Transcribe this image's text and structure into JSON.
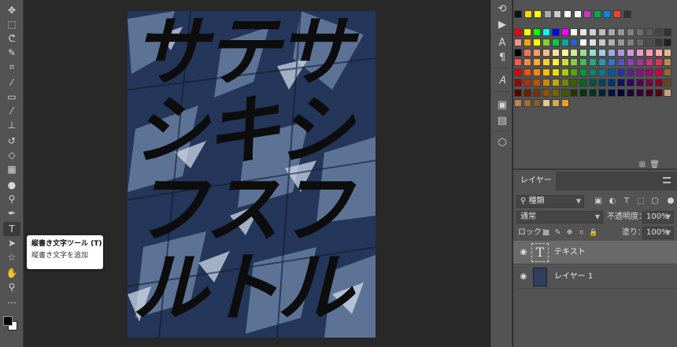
{
  "toolbar": {
    "tools": [
      {
        "name": "move-tool-icon",
        "glyph": "✥"
      },
      {
        "name": "marquee-tool-icon",
        "glyph": "⬚"
      },
      {
        "name": "lasso-tool-icon",
        "glyph": "ᕦ"
      },
      {
        "name": "quick-select-tool-icon",
        "glyph": "✎"
      },
      {
        "name": "crop-tool-icon",
        "glyph": "⌗"
      },
      {
        "name": "eyedropper-tool-icon",
        "glyph": "⁄"
      },
      {
        "name": "healing-brush-tool-icon",
        "glyph": "▭"
      },
      {
        "name": "brush-tool-icon",
        "glyph": "⁄"
      },
      {
        "name": "clone-stamp-tool-icon",
        "glyph": "⊥"
      },
      {
        "name": "history-brush-tool-icon",
        "glyph": "↺"
      },
      {
        "name": "eraser-tool-icon",
        "glyph": "◇"
      },
      {
        "name": "gradient-tool-icon",
        "glyph": "▦"
      },
      {
        "name": "blur-tool-icon",
        "glyph": "●"
      },
      {
        "name": "dodge-tool-icon",
        "glyph": "⚲"
      },
      {
        "name": "pen-tool-icon",
        "glyph": "✒"
      },
      {
        "name": "type-tool-icon",
        "glyph": "T"
      },
      {
        "name": "path-select-tool-icon",
        "glyph": "➤"
      },
      {
        "name": "shape-tool-icon",
        "glyph": "☆"
      },
      {
        "name": "hand-tool-icon",
        "glyph": "✋"
      },
      {
        "name": "zoom-tool-icon",
        "glyph": "⚲"
      },
      {
        "name": "more-tools-icon",
        "glyph": "···"
      }
    ],
    "active_tool": "type-tool-icon"
  },
  "tooltip": {
    "title": "縦書き文字ツール (T)",
    "description": "縦書き文字を追加"
  },
  "document": {
    "poster_lines": [
      "サテサ",
      "シキシ",
      "フスフ",
      "ルトル"
    ]
  },
  "swatches": {
    "recent": [
      "#111111",
      "#ffd800",
      "#ffff00",
      "#aaaaaa",
      "#cccccc",
      "#ffffff",
      "#ffffff",
      "#cc33cc",
      "#00aa55",
      "#0088dd",
      "#ee4433",
      "#333333"
    ],
    "grid": [
      [
        "#ff0000",
        "#ffff00",
        "#00ff00",
        "#00ffff",
        "#0000ff",
        "#ff00ff",
        "#ffffff",
        "#e6e6e6",
        "#d0d0d0",
        "#bcbcbc",
        "#a8a8a8",
        "#969696",
        "#828282",
        "#6e6e6e",
        "#5a5a5a",
        "#464646",
        "#323232"
      ],
      [
        "#f5908a",
        "#ffa500",
        "#ffff00",
        "#88cc33",
        "#00cc44",
        "#00aa99",
        "#2266cc",
        "#ffffff",
        "#e0e0e0",
        "#c8c8c8",
        "#b0b0b0",
        "#999999",
        "#808080",
        "#686868",
        "#505050",
        "#383838",
        "#202020"
      ],
      [
        "#000000",
        "#ff7755",
        "#ff9966",
        "#ffbb88",
        "#ffdd99",
        "#ffff99",
        "#ccee99",
        "#99dd99",
        "#99ddcc",
        "#99ccee",
        "#99aadd",
        "#aa99dd",
        "#cc99dd",
        "#ee99cc",
        "#ff99bb",
        "#ffaaaa",
        "#ddbb99"
      ],
      [
        "#ff5555",
        "#ff8844",
        "#ffaa33",
        "#ffcc33",
        "#ffee33",
        "#ccdd33",
        "#88cc44",
        "#44bb55",
        "#22aa88",
        "#2299bb",
        "#3377cc",
        "#5555bb",
        "#8844bb",
        "#aa3399",
        "#cc3377",
        "#dd3355",
        "#bb8855"
      ],
      [
        "#dd0000",
        "#ee5500",
        "#ff8800",
        "#ffbb00",
        "#eedd00",
        "#aacc00",
        "#55aa00",
        "#009933",
        "#008866",
        "#007799",
        "#0055aa",
        "#2233aa",
        "#552299",
        "#881188",
        "#aa0066",
        "#cc0044",
        "#996633"
      ],
      [
        "#990000",
        "#aa3300",
        "#bb5500",
        "#cc8800",
        "#bbaa00",
        "#778800",
        "#336600",
        "#006622",
        "#005544",
        "#004466",
        "#003377",
        "#111166",
        "#330066",
        "#550055",
        "#770044",
        "#880022",
        "#664422"
      ],
      [
        "#550000",
        "#662200",
        "#773300",
        "#885500",
        "#776600",
        "#445500",
        "#223300",
        "#003311",
        "#003322",
        "#002233",
        "#001144",
        "#000033",
        "#1a0033",
        "#330033",
        "#440022",
        "#550011",
        "#c9a27a"
      ],
      [
        "#b8864b",
        "#a06d38",
        "#8c5a2b",
        "#e8c88a",
        "#d4a857",
        "#f0a020"
      ]
    ]
  },
  "layers_panel": {
    "tab_label": "レイヤー",
    "filter_kind": "種類",
    "blend_mode": "通常",
    "opacity_label": "不透明度：",
    "opacity_value": "100%",
    "lock_label": "ロック：",
    "fill_label": "塗り：",
    "fill_value": "100%",
    "layers": [
      {
        "name": "テキスト",
        "type": "text",
        "thumb_glyph": "T",
        "selected": true
      },
      {
        "name": "レイヤー 1",
        "type": "image",
        "selected": false
      }
    ]
  }
}
